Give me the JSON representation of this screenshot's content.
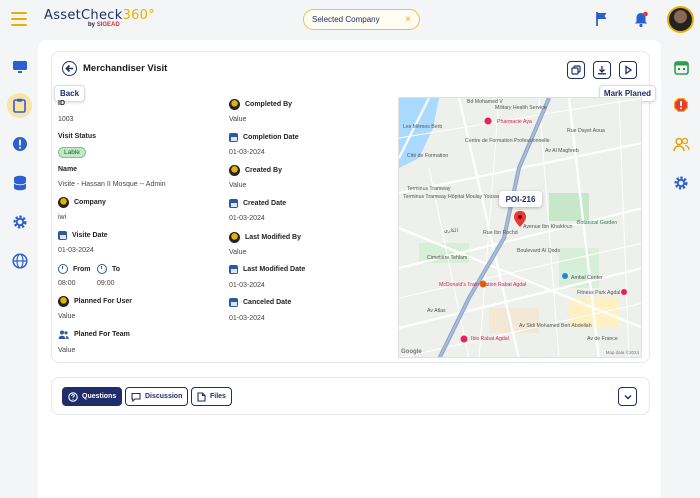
{
  "header": {
    "logo_text": "AssetCheck",
    "logo_number": "360°",
    "logo_by": "by",
    "logo_brand": "SIGEAD",
    "company_selector": "Selected Company",
    "company_clear": "×"
  },
  "page": {
    "title": "Merchandiser Visit",
    "back_tooltip": "Back",
    "mark_tooltip": "Mark Planed"
  },
  "details": {
    "id_label": "ID",
    "id_value": "1003",
    "status_label": "Visit Status",
    "status_value": "Lable",
    "name_label": "Name",
    "name_value": "Visite - Hassan II Mosque -- Admin",
    "company_label": "Company",
    "company_value": "iwi",
    "visit_date_label": "Visite Date",
    "visit_date_value": "01-03-2024",
    "from_label": "From",
    "from_value": "08:00",
    "to_label": "To",
    "to_value": "09:00",
    "planned_user_label": "Planned For User",
    "planned_user_value": "Value",
    "planned_team_label": "Planed For Team",
    "planned_team_value": "Value",
    "completed_by_label": "Completed By",
    "completed_by_value": "Value",
    "completion_date_label": "Completion Date",
    "completion_date_value": "01-03-2024",
    "created_by_label": "Created By",
    "created_by_value": "Value",
    "created_date_label": "Created Date",
    "created_date_value": "01-03-2024",
    "modified_by_label": "Last Modified By",
    "modified_by_value": "Value",
    "modified_date_label": "Last Modified Date",
    "modified_date_value": "01-03-2024",
    "canceled_date_label": "Canceled Date",
    "canceled_date_value": "01-03-2024"
  },
  "map": {
    "poi": "POI-216",
    "labels": [
      "Bd Mohamed V",
      "Military Health Service",
      "Pharmacie Aya",
      "Les Mèmes Berb",
      "Centre de Formation Professionnelle",
      "Rue Dayet Aoua",
      "Cité de Formation",
      "Terminus Tramway Hôpital Moulay Youssef",
      "Terminus Tramway",
      "Botanical Garden",
      "الكاري",
      "Cimetière Tehlam",
      "Rue Ibn Rochd",
      "Avenue Ibn Khaldoun",
      "Ambal Center",
      "Fitness Park Agdal",
      "Av Al Maghreb",
      "McDonald's Train Station Rabat Agdal",
      "Ibis Rabat Agdal",
      "Av de France",
      "Boulevard Al Qods",
      "Av Atlas",
      "Av Sidi Mohamed Ben Abdellah"
    ],
    "google": "Google",
    "mapdata": "Map data ©2024"
  },
  "tabs": {
    "questions": "Questions",
    "discussion": "Discussion",
    "files": "Files"
  },
  "colors": {
    "brand": "#1f2d6b",
    "accent": "#e8b100",
    "status_bg": "#bfe8c4",
    "alert": "#d32f2f"
  }
}
